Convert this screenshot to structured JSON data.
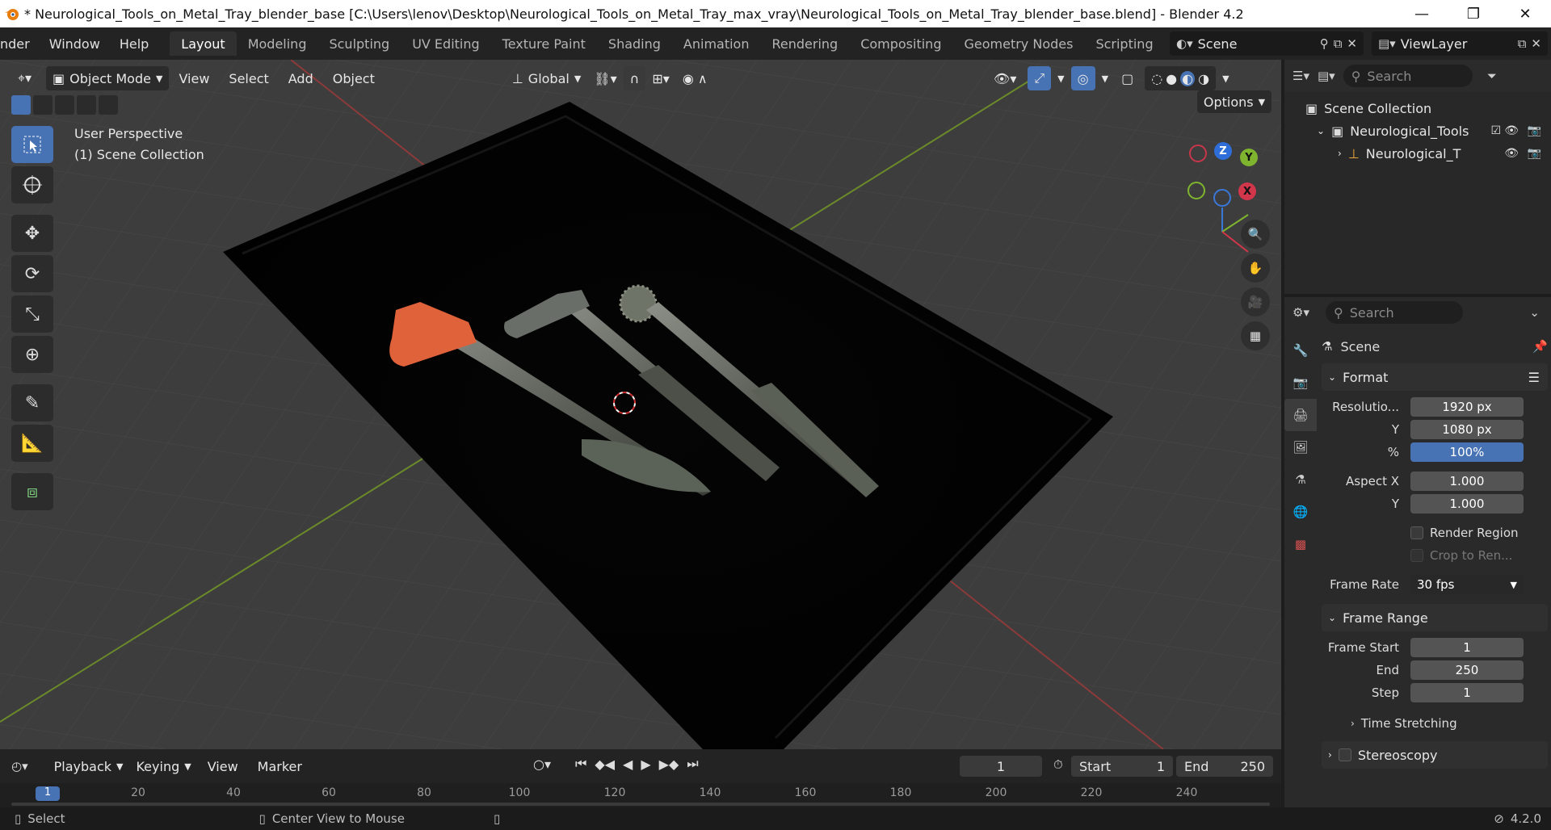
{
  "window": {
    "title": "* Neurological_Tools_on_Metal_Tray_blender_base [C:\\Users\\lenov\\Desktop\\Neurological_Tools_on_Metal_Tray_max_vray\\Neurological_Tools_on_Metal_Tray_blender_base.blend] - Blender 4.2",
    "minimize": "—",
    "maximize": "❐",
    "close": "✕"
  },
  "menu": [
    "nder",
    "Window",
    "Help"
  ],
  "workspaces": {
    "tabs": [
      "Layout",
      "Modeling",
      "Sculpting",
      "UV Editing",
      "Texture Paint",
      "Shading",
      "Animation",
      "Rendering",
      "Compositing",
      "Geometry Nodes",
      "Scripting"
    ],
    "active": "Layout",
    "add": "+"
  },
  "scene_selector": {
    "value": "Scene"
  },
  "viewlayer_selector": {
    "value": "ViewLayer"
  },
  "viewport": {
    "mode": "Object Mode",
    "menus": [
      "View",
      "Select",
      "Add",
      "Object"
    ],
    "transform_orientation": "Global",
    "options_label": "Options",
    "overlay_line1": "User Perspective",
    "overlay_line2": "(1) Scene Collection",
    "gizmo": {
      "z": "Z",
      "y": "Y",
      "x": "X"
    },
    "colors": {
      "background": "#3d3d3d",
      "grid_x": "#8c3a3a",
      "grid_y": "#6b8a2a",
      "accent": "#4772b3"
    }
  },
  "outliner": {
    "search_placeholder": "Search",
    "rows": [
      {
        "label": "Scene Collection"
      },
      {
        "label": "Neurological_Tools"
      },
      {
        "label": "Neurological_T"
      }
    ]
  },
  "properties": {
    "search_placeholder": "Search",
    "context": "Scene",
    "format_panel": "Format",
    "resolution_label": "Resolutio...",
    "resolution_x": "1920 px",
    "y_label": "Y",
    "resolution_y": "1080 px",
    "percent_label": "%",
    "resolution_percent": "100%",
    "aspect_x_label": "Aspect X",
    "aspect_x": "1.000",
    "aspect_y_label": "Y",
    "aspect_y": "1.000",
    "render_region": "Render Region",
    "crop_region": "Crop to Ren...",
    "frame_rate_label": "Frame Rate",
    "frame_rate": "30 fps",
    "frame_range_panel": "Frame Range",
    "frame_start_label": "Frame Start",
    "frame_start": "1",
    "end_label": "End",
    "frame_end": "250",
    "step_label": "Step",
    "frame_step": "1",
    "time_stretching": "Time Stretching",
    "stereoscopy": "Stereoscopy"
  },
  "timeline": {
    "menus": [
      "Playback",
      "Keying",
      "View",
      "Marker"
    ],
    "current_frame": "1",
    "start_label": "Start",
    "start": "1",
    "end_label": "End",
    "end": "250",
    "ticks": [
      "1",
      "20",
      "40",
      "60",
      "80",
      "100",
      "120",
      "140",
      "160",
      "180",
      "200",
      "220",
      "240"
    ]
  },
  "status": {
    "select": "Select",
    "center_view": "Center View to Mouse",
    "version": "4.2.0"
  }
}
